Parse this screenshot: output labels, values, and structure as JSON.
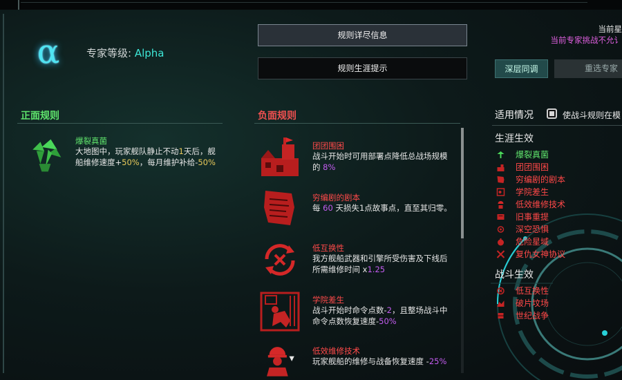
{
  "header": {
    "expert_prefix": "专家等级: ",
    "expert_level": "Alpha",
    "alpha_symbol": "α",
    "status_line1": "当前星",
    "status_line2": "当前专家挑战不允讠"
  },
  "buttons": {
    "details": "规则详尽信息",
    "hints": "规则生涯提示"
  },
  "tabs": {
    "deep": "深层同调",
    "reselect": "重选专家"
  },
  "positive": {
    "title": "正面规则",
    "rules": [
      {
        "name": "爆裂真菌",
        "icon": "mushroom-icon",
        "desc_parts": [
          "大地图中，玩家舰队静止不动",
          "1",
          "天后，舰船维修速度+",
          "50%",
          "，每月维护补给-",
          "50%"
        ]
      }
    ]
  },
  "negative": {
    "title": "负面规则",
    "rules": [
      {
        "name": "团团围困",
        "icon": "siege-castle-icon",
        "d": [
          "战斗开始时可用部署点降低总战场规模的 ",
          "8%",
          ""
        ]
      },
      {
        "name": "穷编剧的剧本",
        "icon": "torn-script-icon",
        "d": [
          "每 ",
          "60",
          " 天损失1点故事点，直至其归零。"
        ]
      },
      {
        "name": "低互换性",
        "icon": "no-swap-icon",
        "d": [
          "我方舰船武器和引擎所受伤害及下线后所需维修时间 x",
          "1.25",
          ""
        ]
      },
      {
        "name": "学院差生",
        "icon": "struggling-student-icon",
        "d": [
          "战斗开始时命令点数-",
          "2",
          "，且整场战斗中命令点数恢复速度-",
          "50%",
          ""
        ]
      },
      {
        "name": "低效维修技术",
        "icon": "mechanic-icon",
        "d": [
          "玩家舰船的维修与战备恢复速度 -",
          "25%",
          ""
        ]
      }
    ]
  },
  "applicability": {
    "title": "适用情况",
    "checkbox_label": "使战斗规则在模",
    "career_title": "生涯生效",
    "career_items": [
      {
        "label": "爆裂真菌",
        "icon": "mushroom-icon",
        "positive": true
      },
      {
        "label": "团团围困",
        "icon": "siege-castle-icon",
        "positive": false
      },
      {
        "label": "穷编剧的剧本",
        "icon": "torn-script-icon",
        "positive": false
      },
      {
        "label": "学院差生",
        "icon": "struggling-student-icon",
        "positive": false
      },
      {
        "label": "低效维修技术",
        "icon": "mechanic-icon",
        "positive": false
      },
      {
        "label": "旧事重提",
        "icon": "old-matters-icon",
        "positive": false
      },
      {
        "label": "深空恐惧",
        "icon": "deep-space-fear-icon",
        "positive": false
      },
      {
        "label": "危险星域",
        "icon": "danger-sector-icon",
        "positive": false
      },
      {
        "label": "复仇女神协议",
        "icon": "nemesis-protocol-icon",
        "positive": false
      }
    ],
    "combat_title": "战斗生效",
    "combat_items": [
      {
        "label": "低互换性",
        "icon": "no-swap-icon",
        "positive": false
      },
      {
        "label": "破片坟场",
        "icon": "debris-graveyard-icon",
        "positive": false
      },
      {
        "label": "世纪战争",
        "icon": "century-war-icon",
        "positive": false
      }
    ]
  },
  "colors": {
    "positive": "#5fe36c",
    "negative": "#ff4a4a",
    "highlight_yellow": "#e8c95a",
    "highlight_purple": "#c45cf0",
    "accent_cyan": "#3ee8d8"
  }
}
